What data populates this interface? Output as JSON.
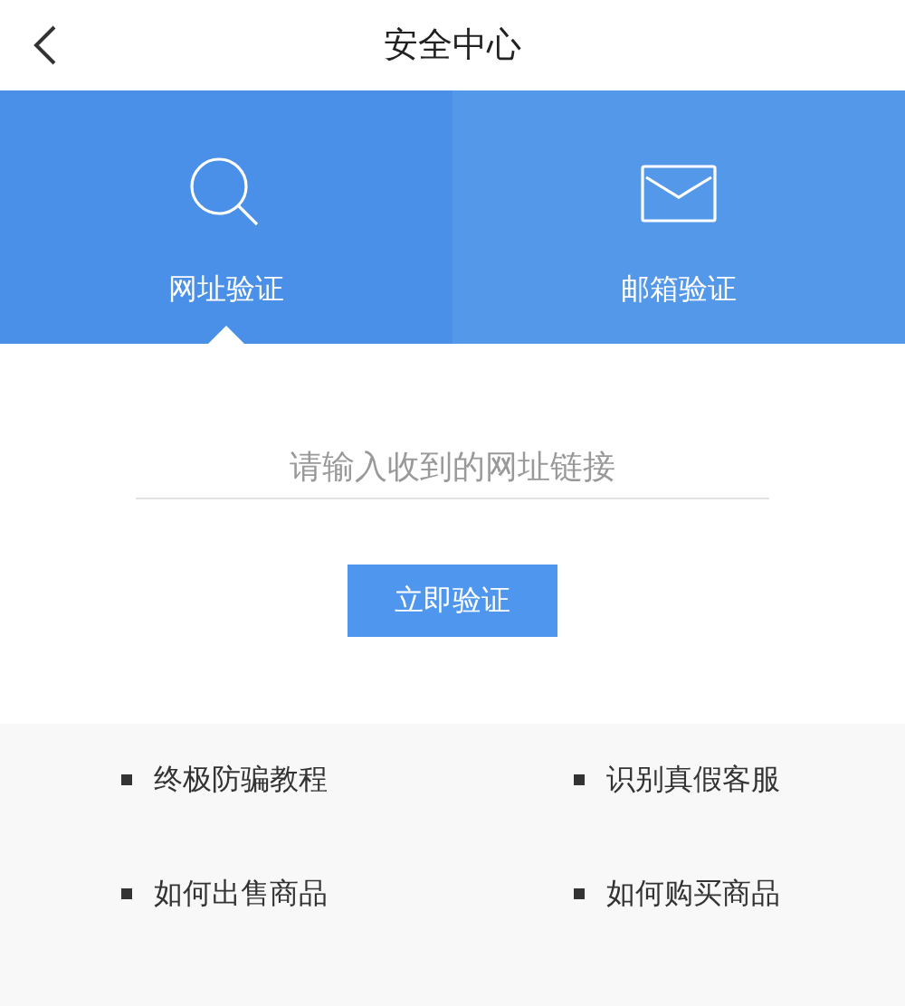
{
  "header": {
    "title": "安全中心"
  },
  "tabs": [
    {
      "label": "网址验证",
      "selected": true
    },
    {
      "label": "邮箱验证",
      "selected": false
    }
  ],
  "url_field": {
    "placeholder": "请输入收到的网址链接"
  },
  "verify_button": "立即验证",
  "links": [
    "终极防骗教程",
    "识别真假客服",
    "如何出售商品",
    "如何购买商品"
  ]
}
